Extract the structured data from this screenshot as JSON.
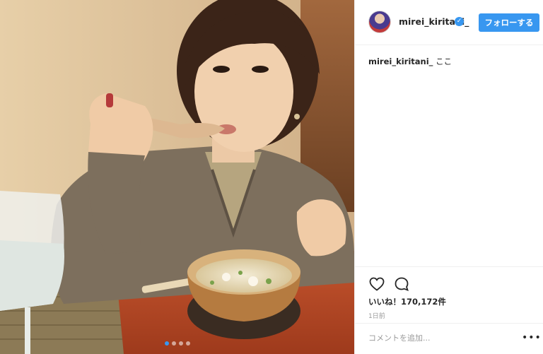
{
  "post": {
    "username": "mirei_kiritani_",
    "verified_icon": "verified-badge-icon",
    "follow_label": "フォローする",
    "caption_user": "mirei_kiritani_",
    "caption_text": "ここ",
    "likes": "いいね！170,172件",
    "time": "1日前",
    "comment_placeholder": "コメントを追加...",
    "more": "•••",
    "carousel": {
      "count": 4,
      "active_index": 0
    }
  },
  "colors": {
    "accent": "#3897f0",
    "text": "#262626",
    "muted": "#999999",
    "divider": "#efefef"
  },
  "icons": {
    "like": "heart-outline-icon",
    "comment": "comment-bubble-icon",
    "more": "more-dots-icon"
  }
}
